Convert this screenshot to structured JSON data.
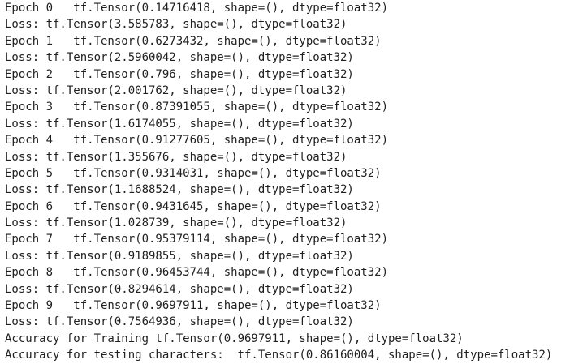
{
  "output": {
    "lines": [
      "Epoch 0   tf.Tensor(0.14716418, shape=(), dtype=float32)",
      "Loss: tf.Tensor(3.585783, shape=(), dtype=float32)",
      "Epoch 1   tf.Tensor(0.6273432, shape=(), dtype=float32)",
      "Loss: tf.Tensor(2.5960042, shape=(), dtype=float32)",
      "Epoch 2   tf.Tensor(0.796, shape=(), dtype=float32)",
      "Loss: tf.Tensor(2.001762, shape=(), dtype=float32)",
      "Epoch 3   tf.Tensor(0.87391055, shape=(), dtype=float32)",
      "Loss: tf.Tensor(1.6174055, shape=(), dtype=float32)",
      "Epoch 4   tf.Tensor(0.91277605, shape=(), dtype=float32)",
      "Loss: tf.Tensor(1.355676, shape=(), dtype=float32)",
      "Epoch 5   tf.Tensor(0.9314031, shape=(), dtype=float32)",
      "Loss: tf.Tensor(1.1688524, shape=(), dtype=float32)",
      "Epoch 6   tf.Tensor(0.9431645, shape=(), dtype=float32)",
      "Loss: tf.Tensor(1.028739, shape=(), dtype=float32)",
      "Epoch 7   tf.Tensor(0.95379114, shape=(), dtype=float32)",
      "Loss: tf.Tensor(0.9189855, shape=(), dtype=float32)",
      "Epoch 8   tf.Tensor(0.96453744, shape=(), dtype=float32)",
      "Loss: tf.Tensor(0.8294614, shape=(), dtype=float32)",
      "Epoch 9   tf.Tensor(0.9697911, shape=(), dtype=float32)",
      "Loss: tf.Tensor(0.7564936, shape=(), dtype=float32)",
      "Accuracy for Training tf.Tensor(0.9697911, shape=(), dtype=float32)",
      "Accuracy for testing characters:  tf.Tensor(0.86160004, shape=(), dtype=float32)"
    ]
  }
}
